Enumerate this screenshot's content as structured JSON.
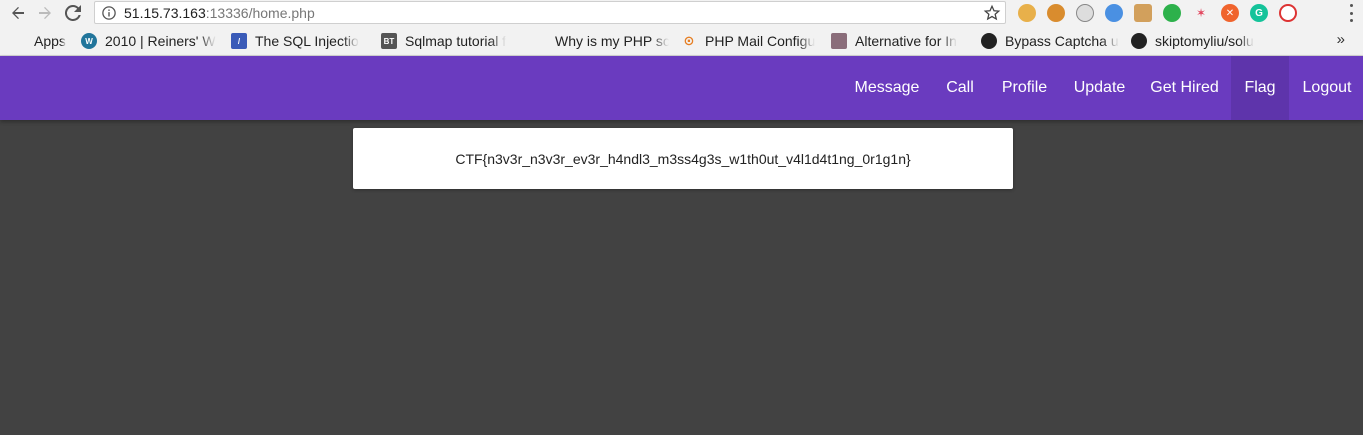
{
  "browser": {
    "url_host": "51.15.73.163",
    "url_path": ":13336/home.php"
  },
  "bookmarks": [
    {
      "label": "Apps",
      "icon": "apps-grid-icon"
    },
    {
      "label": "2010 | Reiners' W",
      "icon": "wordpress-icon"
    },
    {
      "label": "The SQL Injectio",
      "icon": "sql-icon"
    },
    {
      "label": "Sqlmap tutorial f",
      "icon": "bt-icon"
    },
    {
      "label": "Why is my PHP sc",
      "icon": "grid-color-icon"
    },
    {
      "label": "PHP Mail Configu",
      "icon": "search-orange-icon"
    },
    {
      "label": "Alternative for In",
      "icon": "figure-icon"
    },
    {
      "label": "Bypass Captcha u",
      "icon": "github-icon"
    },
    {
      "label": "skiptomyliu/solu",
      "icon": "github-icon"
    }
  ],
  "bookmarks_more": "»",
  "navbar": {
    "items": [
      {
        "label": "Message"
      },
      {
        "label": "Call"
      },
      {
        "label": "Profile"
      },
      {
        "label": "Update"
      },
      {
        "label": "Get Hired"
      },
      {
        "label": "Flag",
        "active": true
      },
      {
        "label": "Logout"
      }
    ]
  },
  "card": {
    "text": "CTF{n3v3r_n3v3r_ev3r_h4ndl3_m3ss4g3s_w1th0ut_v4l1d4t1ng_0r1g1n}"
  },
  "colors": {
    "navbar": "#6a3bbf",
    "navbar_active": "#5e34ab",
    "page_bg": "#424242"
  }
}
